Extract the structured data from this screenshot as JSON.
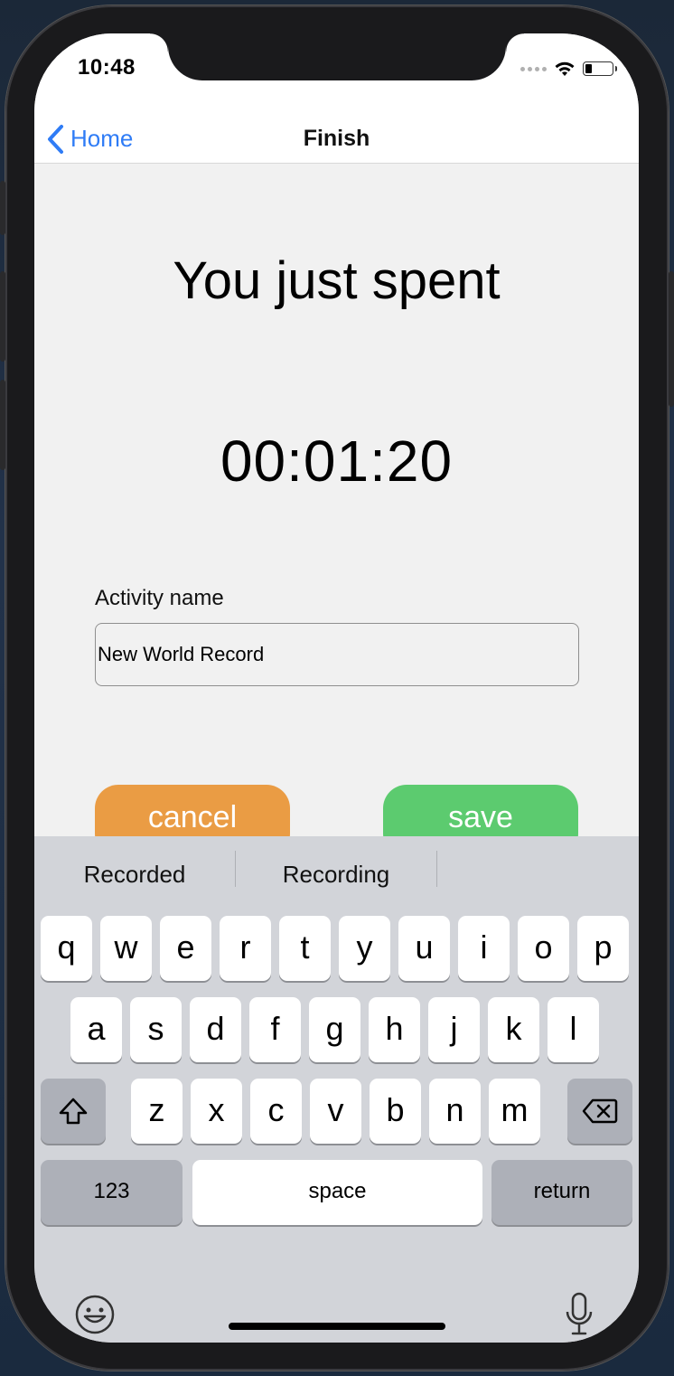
{
  "status": {
    "time": "10:48"
  },
  "nav": {
    "back_label": "Home",
    "title": "Finish"
  },
  "main": {
    "headline": "You just spent",
    "timer": "00:01:20",
    "field_label": "Activity name",
    "field_value": "New World Record",
    "cancel_label": "cancel",
    "save_label": "save"
  },
  "keyboard": {
    "suggestions": [
      "Recorded",
      "Recording",
      ""
    ],
    "row1": [
      "q",
      "w",
      "e",
      "r",
      "t",
      "y",
      "u",
      "i",
      "o",
      "p"
    ],
    "row2": [
      "a",
      "s",
      "d",
      "f",
      "g",
      "h",
      "j",
      "k",
      "l"
    ],
    "row3": [
      "z",
      "x",
      "c",
      "v",
      "b",
      "n",
      "m"
    ],
    "numbers_label": "123",
    "space_label": "space",
    "return_label": "return",
    "icons": {
      "shift": "shift-icon",
      "delete": "delete-icon",
      "emoji": "emoji-icon",
      "mic": "microphone-icon"
    }
  },
  "colors": {
    "accent": "#2f7cf6",
    "cancel": "#ea9c44",
    "save": "#5ccb6f",
    "keyboard_bg": "#d2d4d9"
  }
}
